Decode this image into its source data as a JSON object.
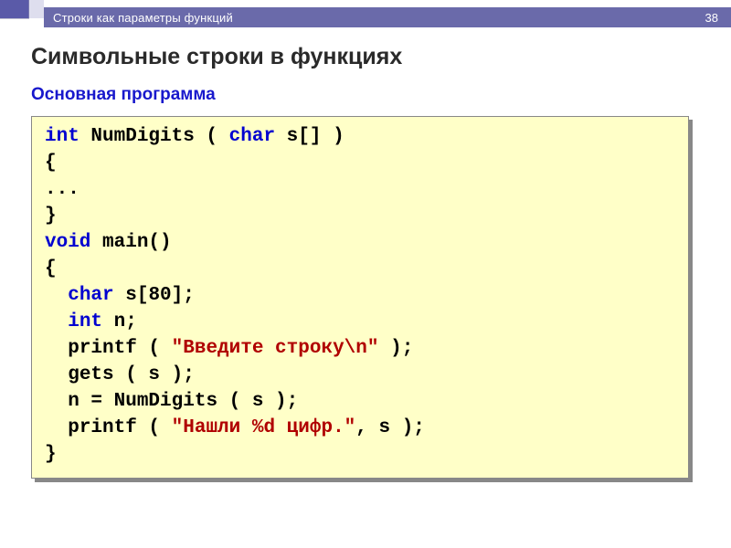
{
  "header": {
    "section_title": "Строки как параметры функций",
    "page_number": "38"
  },
  "slide": {
    "title": "Символьные строки в функциях",
    "subtitle": "Основная программа"
  },
  "code": {
    "l1": {
      "kw1": "int",
      "fn": " NumDigits ( ",
      "kw2": "char",
      "rest": " s[] )"
    },
    "l2": "{",
    "l3": "...",
    "l4": "}",
    "l5": {
      "kw1": "void",
      "rest": " main()"
    },
    "l6": "{",
    "l7": {
      "indent": "  ",
      "kw": "char",
      "rest": " s[80];"
    },
    "l8": {
      "indent": "  ",
      "kw": "int",
      "rest": " n;"
    },
    "l9": {
      "indent": "  ",
      "fn": "printf ( ",
      "str": "\"Введите строку\\n\"",
      "rest": " );"
    },
    "l10": {
      "indent": "  ",
      "txt": "gets ( s );"
    },
    "l11": {
      "indent": "  ",
      "txt": "n = NumDigits ( s );"
    },
    "l12": {
      "indent": "  ",
      "fn": "printf ( ",
      "str": "\"Нашли %d цифр.\"",
      "rest": ", s );"
    },
    "l13": "}"
  }
}
